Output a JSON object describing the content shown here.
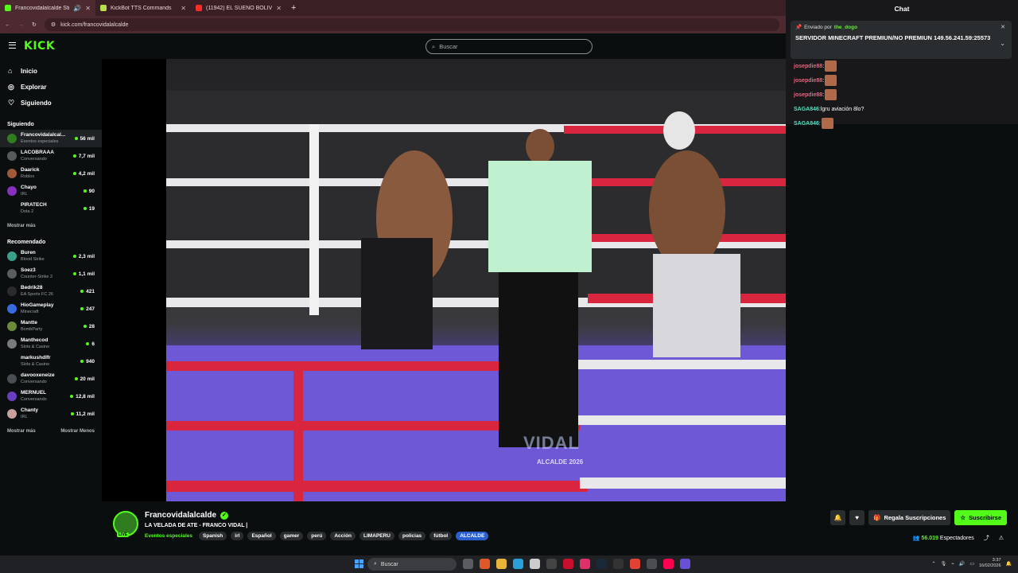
{
  "browser": {
    "tabs": [
      {
        "label": "Francovidalalcalde Stream",
        "color": "#53fc18"
      },
      {
        "label": "KickBot TTS Commands",
        "color": "#b7e04a"
      },
      {
        "label": "(11942) EL SUEÑO BOLIVIANO",
        "color": "#ff2a2a"
      }
    ],
    "new_tab": "+",
    "url": "kick.com/francovidalalcalde"
  },
  "header": {
    "logo": "KICK",
    "search_placeholder": "Buscar"
  },
  "sidebar": {
    "nav": [
      {
        "label": "Inicio",
        "icon": "home-icon"
      },
      {
        "label": "Explorar",
        "icon": "compass-icon"
      },
      {
        "label": "Siguiendo",
        "icon": "heart-icon"
      }
    ],
    "following_title": "Siguiendo",
    "following": [
      {
        "name": "Francovidalalcal...",
        "category": "Eventos especiales",
        "viewers": "56 mil",
        "color": "#2f7d20"
      },
      {
        "name": "LACOBRAAA",
        "category": "Conversando",
        "viewers": "7,7 mil",
        "color": "#555a5c"
      },
      {
        "name": "Daarick",
        "category": "Roblox",
        "viewers": "4,2 mil",
        "color": "#a05a3a"
      },
      {
        "name": "Chayo",
        "category": "IRL",
        "viewers": "90",
        "color": "#8a2fbf"
      },
      {
        "name": "PIRATECH",
        "category": "Dota 2",
        "viewers": "19",
        "color": "#0b0e0f"
      }
    ],
    "show_more": "Mostrar más",
    "recommended_title": "Recomendado",
    "recommended": [
      {
        "name": "Buren",
        "category": "Blood Strike",
        "viewers": "2,3 mil",
        "color": "#3aa08a"
      },
      {
        "name": "Soez3",
        "category": "Counter-Strike 2",
        "viewers": "1,1 mil",
        "color": "#5a5e62"
      },
      {
        "name": "Bedrik28",
        "category": "EA Sports FC 26",
        "viewers": "421",
        "color": "#2b2b2b"
      },
      {
        "name": "HioGameplay",
        "category": "Minecraft",
        "viewers": "247",
        "color": "#3a6adf"
      },
      {
        "name": "Mantte",
        "category": "BombParty",
        "viewers": "28",
        "color": "#6b8b3a"
      },
      {
        "name": "Manthecod",
        "category": "Slots & Casino",
        "viewers": "6",
        "color": "#7a7a7a"
      },
      {
        "name": "markushdlfr",
        "category": "Slots & Casino",
        "viewers": "940",
        "color": "#0b0e0f"
      },
      {
        "name": "davooxeneize",
        "category": "Conversando",
        "viewers": "20 mil",
        "color": "#4a4e52"
      },
      {
        "name": "MERNUEL",
        "category": "Conversando",
        "viewers": "12,8 mil",
        "color": "#6a3fbf"
      },
      {
        "name": "Chanty",
        "category": "IRL",
        "viewers": "11,2 mil",
        "color": "#c8a0a0"
      }
    ],
    "show_more_2": "Mostrar más",
    "show_less": "Mostrar Menos"
  },
  "video": {
    "watermark": "VIDAL",
    "watermark_sub": "ALCALDE 2026"
  },
  "chat": {
    "title": "Chat",
    "pinned_by_label": "Enviado por",
    "pinned_user": "the_dogo",
    "pinned_message": "SERVIDOR MINECRAFT PREMIUN/NO PREMIUN 149.56.241.59:25573",
    "messages": [
      {
        "user": "josepdie88",
        "text": "",
        "color": "#ff5a7a",
        "emote": true
      },
      {
        "user": "josepdie88",
        "text": "",
        "color": "#ff5a7a",
        "emote": true
      },
      {
        "user": "josepdie88",
        "text": "",
        "color": "#ff5a7a",
        "emote": true
      },
      {
        "user": "SAGA846",
        "text": "lgru aviación 8lo?",
        "color": "#53e0c0",
        "emote": false
      },
      {
        "user": "SAGA846",
        "text": "",
        "color": "#53e0c0",
        "emote": true
      }
    ]
  },
  "stream": {
    "streamer": "Francovidalalcalde",
    "live_badge": "LIVE",
    "title": "LA VELADA DE ATE - FRANCO VIDAL |",
    "category": "Eventos especiales",
    "tags": [
      "Spanish",
      "irl",
      "Español",
      "gamer",
      "perú",
      "Acción",
      "LIMAPERU",
      "policias",
      "fútbol",
      "ALCALDE"
    ],
    "gift_label": "Regala Suscripciones",
    "subscribe_label": "Suscribirse",
    "viewers": "56.019",
    "viewers_label": "Espectadores"
  },
  "taskbar": {
    "search": "Buscar",
    "time": "3:37",
    "date": "16/02/2026"
  }
}
